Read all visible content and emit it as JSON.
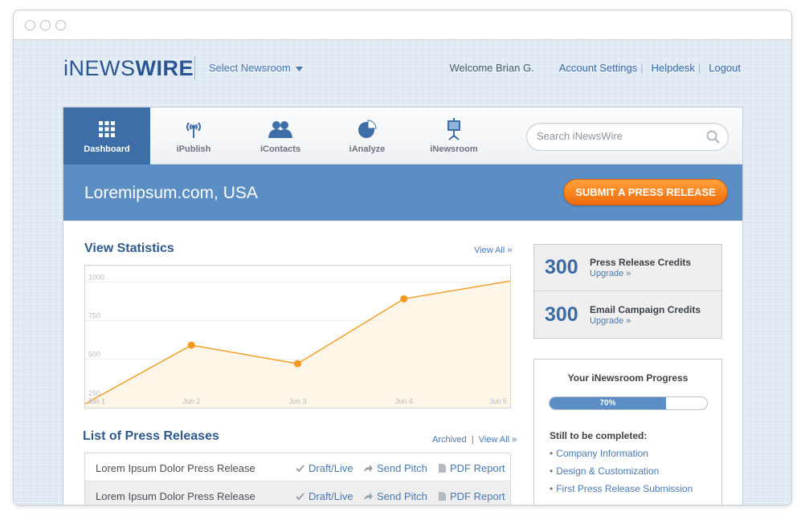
{
  "header": {
    "logo_light": "iNEWS",
    "logo_bold": "WIRE",
    "newsroom_select": "Select Newsroom",
    "welcome": "Welcome Brian G.",
    "account_settings": "Account Settings",
    "helpdesk": "Helpdesk",
    "logout": "Logout",
    "separator": "|"
  },
  "nav": {
    "items": [
      {
        "label": "Dashboard",
        "icon": "grid-icon",
        "active": true
      },
      {
        "label": "iPublish",
        "icon": "antenna-icon",
        "active": false
      },
      {
        "label": "iContacts",
        "icon": "contacts-icon",
        "active": false
      },
      {
        "label": "iAnalyze",
        "icon": "pie-chart-icon",
        "active": false
      },
      {
        "label": "iNewsroom",
        "icon": "presentation-icon",
        "active": false
      }
    ],
    "search_placeholder": "Search iNewsWire"
  },
  "banner": {
    "title": "Loremipsum.com, USA",
    "submit_label": "SUBMIT A PRESS RELEASE"
  },
  "statistics": {
    "title": "View Statistics",
    "view_all": "View All »"
  },
  "chart_data": {
    "type": "line",
    "x": [
      "Jun 1",
      "Jun 2",
      "Jun 3",
      "Jun 4",
      "Jun 5"
    ],
    "series": [
      {
        "values": [
          175,
          555,
          435,
          855,
          970
        ]
      }
    ],
    "y_ticks": [
      "1000",
      "750",
      "500",
      "250"
    ],
    "ylim": [
      150,
      1070
    ],
    "grid": true,
    "colors": {
      "line": "#f3a12a",
      "fill": "#fdf5e8",
      "point": "#f39a1e"
    }
  },
  "press_releases": {
    "title": "List of Press Releases",
    "archived": "Archived",
    "separator": "|",
    "view_all": "View All »",
    "rows": [
      {
        "title": "Lorem Ipsum Dolor Press Release",
        "status": "Draft/Live",
        "pitch": "Send Pitch",
        "report": "PDF Report"
      },
      {
        "title": "Lorem Ipsum Dolor Press Release",
        "status": "Draft/Live",
        "pitch": "Send Pitch",
        "report": "PDF Report"
      }
    ]
  },
  "credits": {
    "press": {
      "count": "300",
      "label": "Press Release Credits",
      "upgrade": "Upgrade »"
    },
    "email": {
      "count": "300",
      "label": "Email Campaign Credits",
      "upgrade": "Upgrade »"
    }
  },
  "progress": {
    "title": "Your iNewsroom Progress",
    "percent_label": "70%",
    "value": 0.74,
    "still_title": "Still to be completed:",
    "bullet": "•",
    "items": [
      "Company Information",
      "Design & Customization",
      "First Press Release Submission"
    ]
  },
  "colors": {
    "brand": "#2a5590",
    "accent": "#5b8ec4",
    "nav_active": "#3d6ea8",
    "cta": "#f26a0b"
  }
}
